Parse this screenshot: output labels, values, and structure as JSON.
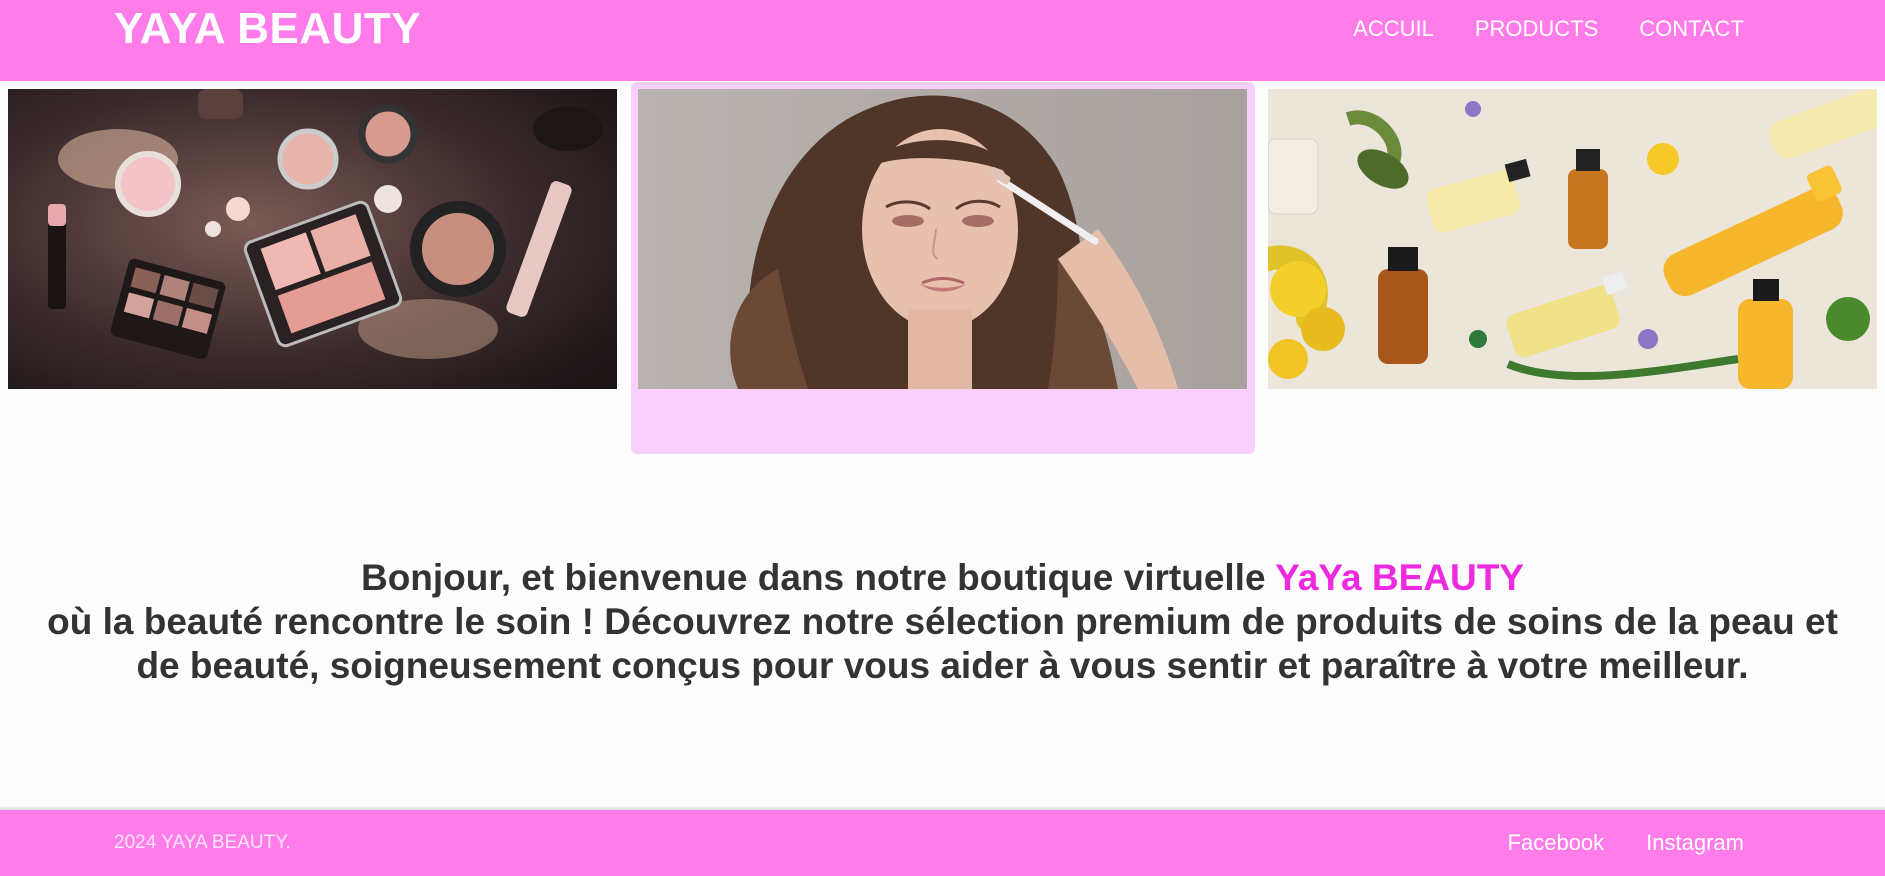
{
  "header": {
    "brand": "YAYA BEAUTY",
    "nav": [
      "ACCUIL",
      "PRODUCTS",
      "CONTACT"
    ]
  },
  "gallery": {
    "images": [
      "makeup-products-image",
      "woman-applying-eyeshadow-image",
      "skincare-bottles-image"
    ]
  },
  "welcome": {
    "line1": "Bonjour, et bienvenue dans notre boutique virtuelle ",
    "brand": "YaYa BEAUTY",
    "line2": "où la beauté rencontre le soin ! Découvrez notre sélection premium de produits de soins de la peau et",
    "line3": "de beauté, soigneusement conçus pour vous aider à vous sentir et paraître à votre meilleur."
  },
  "footer": {
    "copyright": "2024 YAYA BEAUTY.",
    "links": [
      "Facebook",
      "Instagram"
    ]
  },
  "colors": {
    "header_footer_bg": "#ff7ce9",
    "accent": "#ee2ae0",
    "highlight_card_bg": "#f9cffc",
    "text": "#333333"
  }
}
